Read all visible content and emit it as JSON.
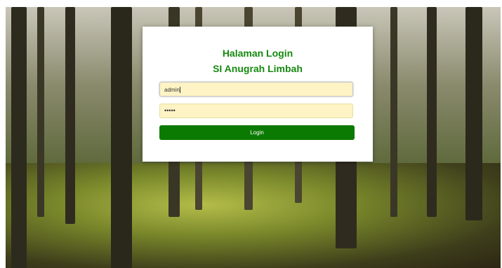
{
  "background": {
    "scene": "forest",
    "accent": "#15890e"
  },
  "login": {
    "title_line1": "Halaman Login",
    "title_line2": "SI Anugrah Limbah",
    "username_value": "admin",
    "password_value": "•••••",
    "button_label": "Login"
  },
  "colors": {
    "button": "#0b7a02",
    "title": "#15890e",
    "input_bg": "#fdf3c4"
  }
}
